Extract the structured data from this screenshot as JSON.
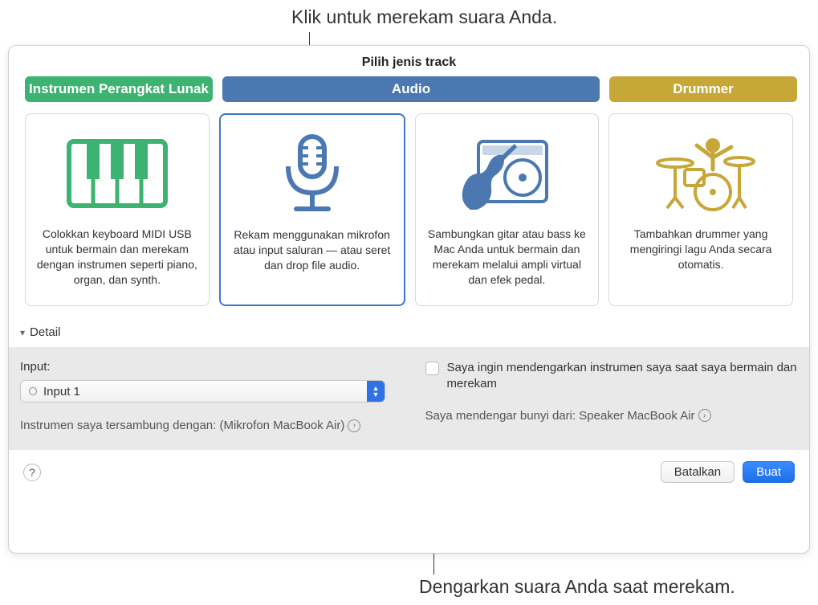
{
  "callouts": {
    "top": "Klik untuk merekam suara Anda.",
    "bottom": "Dengarkan suara Anda saat merekam."
  },
  "dialog": {
    "title": "Pilih jenis track",
    "tabs": {
      "software": "Instrumen Perangkat Lunak",
      "audio": "Audio",
      "drummer": "Drummer"
    },
    "cards": {
      "keyboard": "Colokkan keyboard MIDI USB untuk bermain dan merekam dengan instrumen seperti piano, organ, dan synth.",
      "mic": "Rekam menggunakan mikrofon atau input saluran — atau seret dan drop file audio.",
      "guitar": "Sambungkan gitar atau bass ke Mac Anda untuk bermain dan merekam melalui ampli virtual dan efek pedal.",
      "drummer": "Tambahkan drummer yang mengiringi lagu Anda secara otomatis."
    },
    "detail": {
      "header": "Detail",
      "input_label": "Input:",
      "input_value": "Input 1",
      "connected_text": "Instrumen saya tersambung dengan: (Mikrofon MacBook Air)",
      "monitor_label": "Saya ingin mendengarkan instrumen saya saat saya bermain dan merekam",
      "output_text": "Saya mendengar bunyi dari: Speaker MacBook Air"
    },
    "footer": {
      "cancel": "Batalkan",
      "create": "Buat"
    }
  }
}
